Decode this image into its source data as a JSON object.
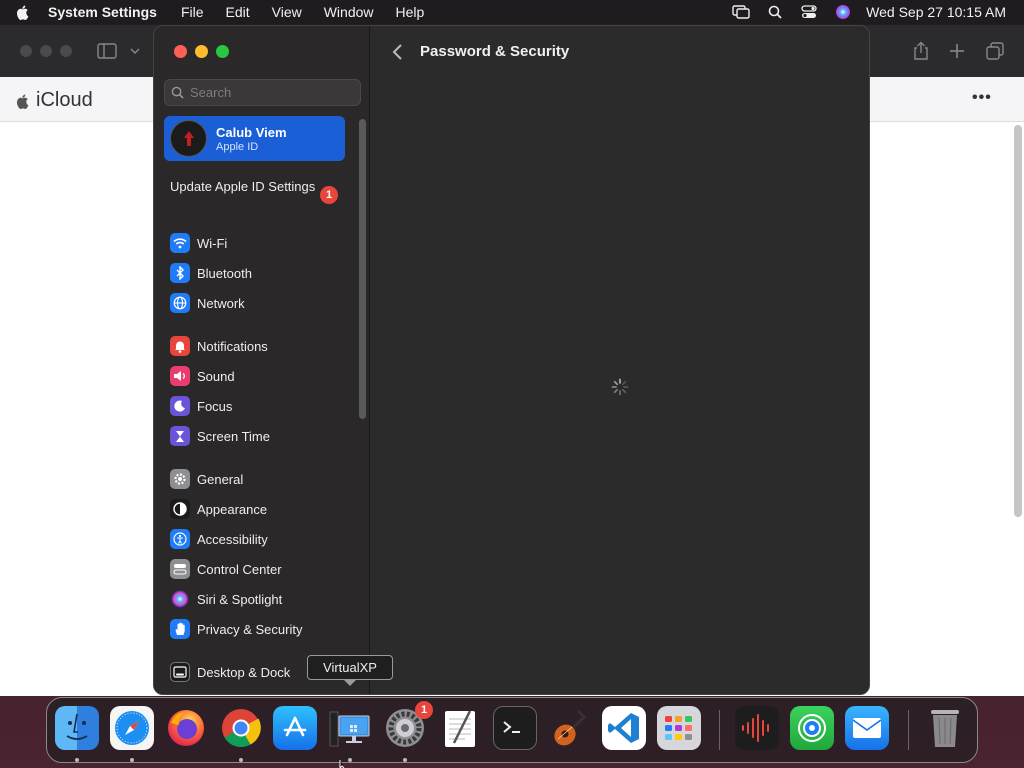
{
  "menubar": {
    "app_name": "System Settings",
    "menus": [
      "File",
      "Edit",
      "View",
      "Window",
      "Help"
    ],
    "clock": "Wed Sep 27  10:15 AM"
  },
  "browser": {
    "brand": "iCloud",
    "more_label": "•••"
  },
  "settings": {
    "search_placeholder": "Search",
    "account": {
      "name": "Calub Viem",
      "subtitle": "Apple ID"
    },
    "update_label": "Update Apple ID Settings",
    "update_badge": "1",
    "sidebar_items": [
      {
        "label": "Wi-Fi",
        "icon": "wifi-icon",
        "color": "#1f7bf6"
      },
      {
        "label": "Bluetooth",
        "icon": "bluetooth-icon",
        "color": "#1f7bf6"
      },
      {
        "label": "Network",
        "icon": "globe-icon",
        "color": "#1f7bf6"
      },
      {
        "label": "Notifications",
        "icon": "bell-icon",
        "color": "#e8453c"
      },
      {
        "label": "Sound",
        "icon": "speaker-icon",
        "color": "#e83d6e"
      },
      {
        "label": "Focus",
        "icon": "moon-icon",
        "color": "#6a55d8"
      },
      {
        "label": "Screen Time",
        "icon": "hourglass-icon",
        "color": "#6a55d8"
      },
      {
        "label": "General",
        "icon": "gear-icon",
        "color": "#8e8e93"
      },
      {
        "label": "Appearance",
        "icon": "appearance-icon",
        "color": "#1b1b1b"
      },
      {
        "label": "Accessibility",
        "icon": "accessibility-icon",
        "color": "#1f7bf6"
      },
      {
        "label": "Control Center",
        "icon": "control-center-icon",
        "color": "#8e8e93"
      },
      {
        "label": "Siri & Spotlight",
        "icon": "siri-icon",
        "color": "#b03ad6"
      },
      {
        "label": "Privacy & Security",
        "icon": "hand-icon",
        "color": "#1f7bf6"
      },
      {
        "label": "Desktop & Dock",
        "icon": "dock-icon",
        "color": "#1b1b1b"
      }
    ],
    "content_title": "Password & Security"
  },
  "tooltip": {
    "label": "VirtualXP"
  },
  "dock": {
    "settings_badge": "1"
  }
}
